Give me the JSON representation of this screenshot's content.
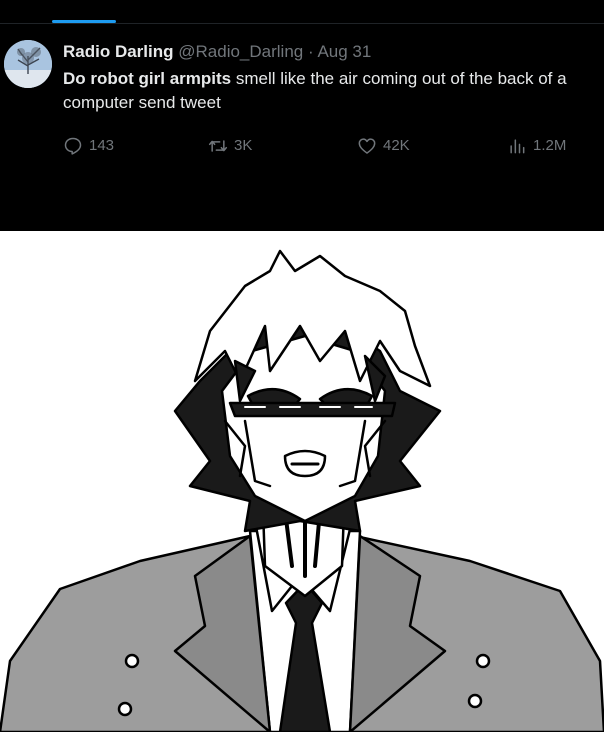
{
  "tweet": {
    "display_name": "Radio Darling",
    "handle": "@Radio_Darling",
    "separator": "·",
    "date": "Aug 31",
    "text_bold": "Do robot girl armpits",
    "text_rest_line1": " smell like the air coming out of the back of a",
    "text_line2": "computer send tweet",
    "actions": {
      "replies": "143",
      "retweets": "3K",
      "likes": "42K",
      "views": "1.2M"
    }
  },
  "colors": {
    "background_tweet": "#000000",
    "name": "#e7e9ea",
    "secondary": "#71767b",
    "accent": "#1d9bf0"
  },
  "icons": {
    "reply": "speech-bubble-icon",
    "retweet": "retweet-arrows-icon",
    "like": "heart-icon",
    "views": "bar-chart-icon"
  }
}
